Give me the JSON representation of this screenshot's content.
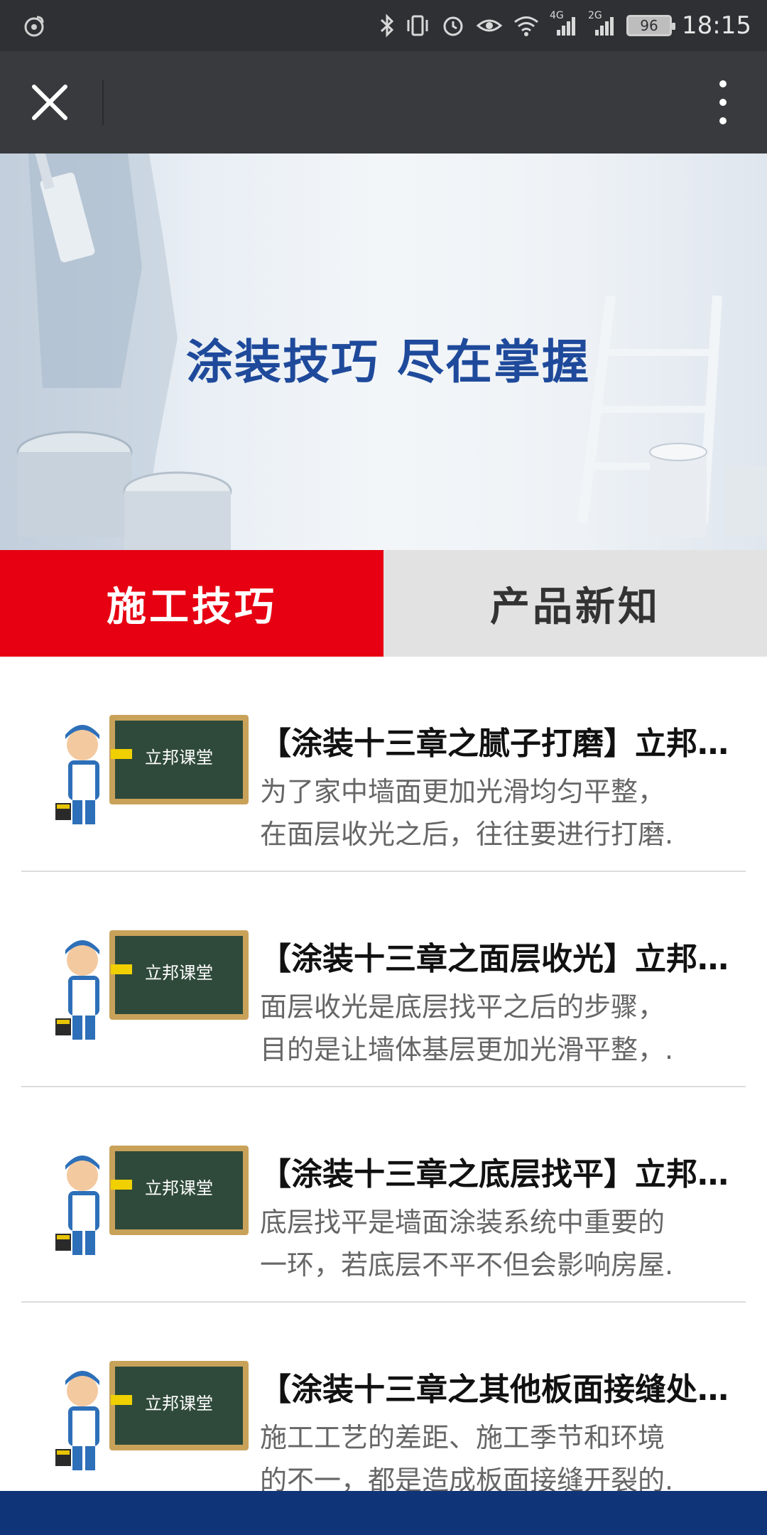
{
  "status_bar": {
    "time": "18:15",
    "battery": "96",
    "network_1": "4G",
    "network_2": "2G"
  },
  "app_bar": {
    "close_icon": "close-icon",
    "more_icon": "more-vertical-icon"
  },
  "banner": {
    "title": "涂装技巧  尽在掌握"
  },
  "tabs": [
    {
      "label": "施工技巧",
      "active": true
    },
    {
      "label": "产品新知",
      "active": false
    }
  ],
  "thumbnail_label": "立邦课堂",
  "articles": [
    {
      "title": "【涂装十三章之腻子打磨】立邦课堂",
      "desc_line1": "为了家中墙面更加光滑均匀平整，",
      "desc_line2": "在面层收光之后，往往要进行打磨."
    },
    {
      "title": "【涂装十三章之面层收光】立邦课堂",
      "desc_line1": "面层收光是底层找平之后的步骤，",
      "desc_line2": "目的是让墙体基层更加光滑平整，."
    },
    {
      "title": "【涂装十三章之底层找平】立邦课堂",
      "desc_line1": "底层找平是墙面涂装系统中重要的",
      "desc_line2": "一环，若底层不平不但会影响房屋."
    },
    {
      "title": "【涂装十三章之其他板面接缝处理】",
      "desc_line1": "施工工艺的差距、施工季节和环境",
      "desc_line2": "的不一，都是造成板面接缝开裂的."
    }
  ],
  "colors": {
    "accent_red": "#e60012",
    "brand_blue": "#1f4a9b",
    "bottom_bar": "#0f3477"
  }
}
